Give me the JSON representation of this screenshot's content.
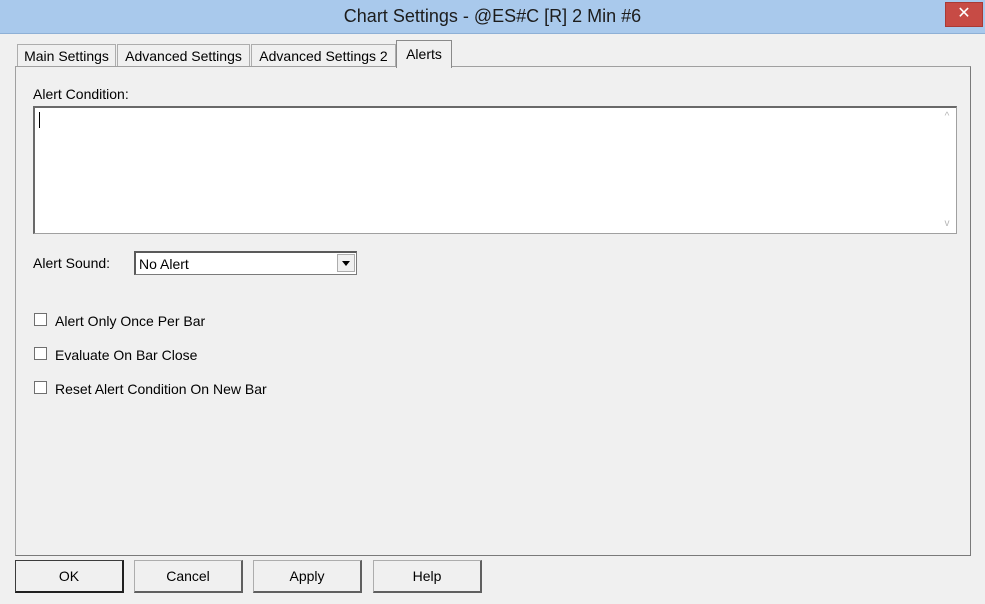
{
  "window": {
    "title": "Chart Settings - @ES#C [R]  2 Min   #6",
    "close_label": "✕"
  },
  "tabs": [
    {
      "label": "Main Settings",
      "active": false
    },
    {
      "label": "Advanced Settings",
      "active": false
    },
    {
      "label": "Advanced Settings 2",
      "active": false
    },
    {
      "label": "Alerts",
      "active": true
    }
  ],
  "alerts": {
    "condition_label": "Alert Condition:",
    "condition_value": "",
    "sound_label": "Alert Sound:",
    "sound_value": "No Alert",
    "options": [
      {
        "label": "Alert Only Once Per Bar",
        "checked": false
      },
      {
        "label": "Evaluate On Bar Close",
        "checked": false
      },
      {
        "label": "Reset Alert Condition On New Bar",
        "checked": false
      }
    ]
  },
  "buttons": {
    "ok": "OK",
    "cancel": "Cancel",
    "apply": "Apply",
    "help": "Help"
  }
}
